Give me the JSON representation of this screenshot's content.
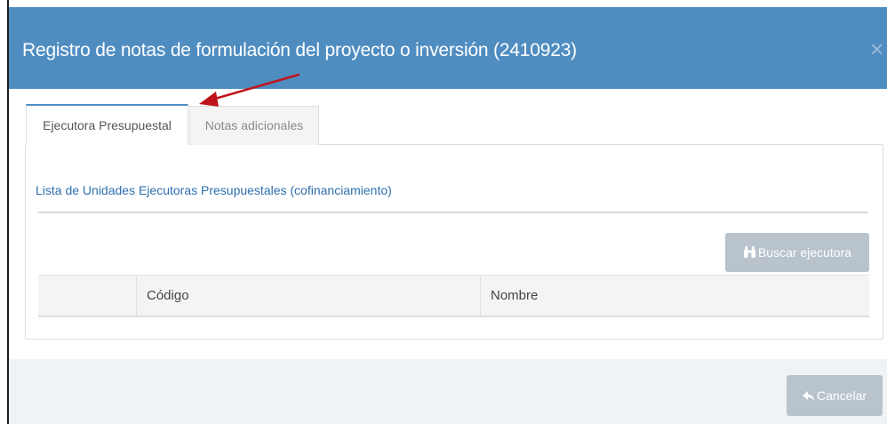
{
  "modal": {
    "title": "Registro de notas de formulación del proyecto o inversión (2410923)",
    "close_label": "×"
  },
  "tabs": [
    {
      "label": "Ejecutora Presupuestal",
      "active": true
    },
    {
      "label": "Notas adicionales",
      "active": false
    }
  ],
  "section": {
    "title": "Lista de Unidades Ejecutoras Presupuestales (cofinanciamiento)"
  },
  "buttons": {
    "buscar_label": "Buscar ejecutora",
    "buscar_icon": "binoculars-icon",
    "cancelar_label": "Cancelar",
    "cancelar_icon": "reply-icon"
  },
  "table": {
    "columns": [
      "",
      "Código",
      "Nombre"
    ]
  },
  "colors": {
    "header": "#4f8dc1",
    "link": "#2f6fae",
    "button": "#b8c3cc",
    "annotation_arrow": "#c0141a"
  }
}
